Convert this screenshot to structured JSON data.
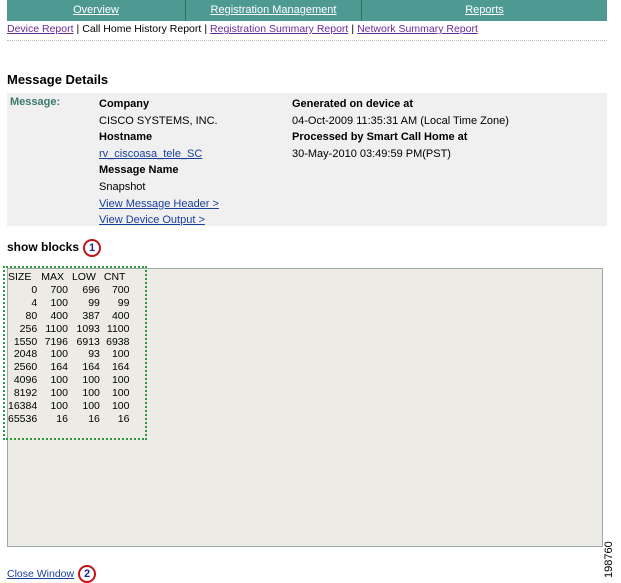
{
  "nav": {
    "tabs": [
      "Overview",
      "Registration Management",
      "Reports"
    ]
  },
  "subnav": {
    "items": [
      "Device Report",
      "Call Home History Report",
      "Registration Summary Report",
      "Network Summary Report"
    ]
  },
  "title": "Message Details",
  "details": {
    "label": "Message:",
    "company_label": "Company",
    "company": "CISCO SYSTEMS, INC.",
    "hostname_label": "Hostname",
    "hostname": "rv_ciscoasa_tele_SC",
    "message_name_label": "Message Name",
    "message_name": "Snapshot",
    "view_header": "View Message Header >",
    "view_output": "View Device Output >",
    "generated_label": "Generated on device at",
    "generated": "04-Oct-2009 11:35:31 AM (Local Time Zone)",
    "processed_label": "Processed by Smart Call Home at",
    "processed": "30-May-2010 03:49:59 PM(PST)"
  },
  "section": {
    "title": "show blocks",
    "callout1": "1",
    "callout2": "2"
  },
  "output": {
    "headers": [
      "SIZE",
      "MAX",
      "LOW",
      "CNT"
    ],
    "rows": [
      [
        "0",
        "700",
        "696",
        "700"
      ],
      [
        "4",
        "100",
        "99",
        "99"
      ],
      [
        "80",
        "400",
        "387",
        "400"
      ],
      [
        "256",
        "1100",
        "1093",
        "1100"
      ],
      [
        "1550",
        "7196",
        "6913",
        "6938"
      ],
      [
        "2048",
        "100",
        "93",
        "100"
      ],
      [
        "2560",
        "164",
        "164",
        "164"
      ],
      [
        "4096",
        "100",
        "100",
        "100"
      ],
      [
        "8192",
        "100",
        "100",
        "100"
      ],
      [
        "16384",
        "100",
        "100",
        "100"
      ],
      [
        "65536",
        "16",
        "16",
        "16"
      ]
    ]
  },
  "close": "Close Window",
  "figure_number": "198760"
}
